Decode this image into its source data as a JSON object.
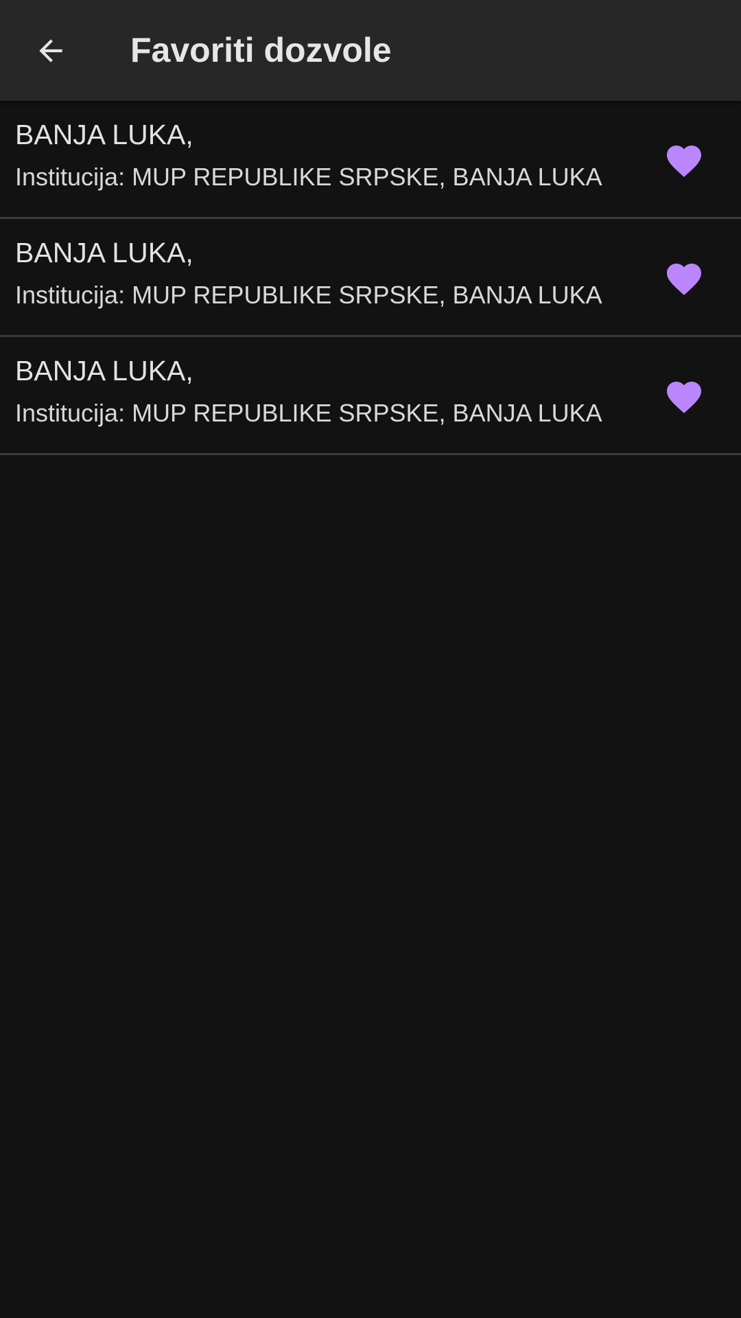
{
  "toolbar": {
    "back_icon": "arrow-left-icon",
    "title": "Favoriti dozvole"
  },
  "colors": {
    "background": "#121212",
    "toolbar": "#272727",
    "accent_heart": "#bb86fc",
    "text": "#e3e3e3",
    "divider": "#3a3a3a"
  },
  "favorites": [
    {
      "title": "BANJA LUKA,",
      "subtitle": "Institucija: MUP REPUBLIKE SRPSKE, BANJA LUKA",
      "icon": "heart-filled-icon"
    },
    {
      "title": "BANJA LUKA,",
      "subtitle": "Institucija: MUP REPUBLIKE SRPSKE, BANJA LUKA",
      "icon": "heart-filled-icon"
    },
    {
      "title": "BANJA LUKA,",
      "subtitle": "Institucija: MUP REPUBLIKE SRPSKE, BANJA LUKA",
      "icon": "heart-filled-icon"
    }
  ]
}
